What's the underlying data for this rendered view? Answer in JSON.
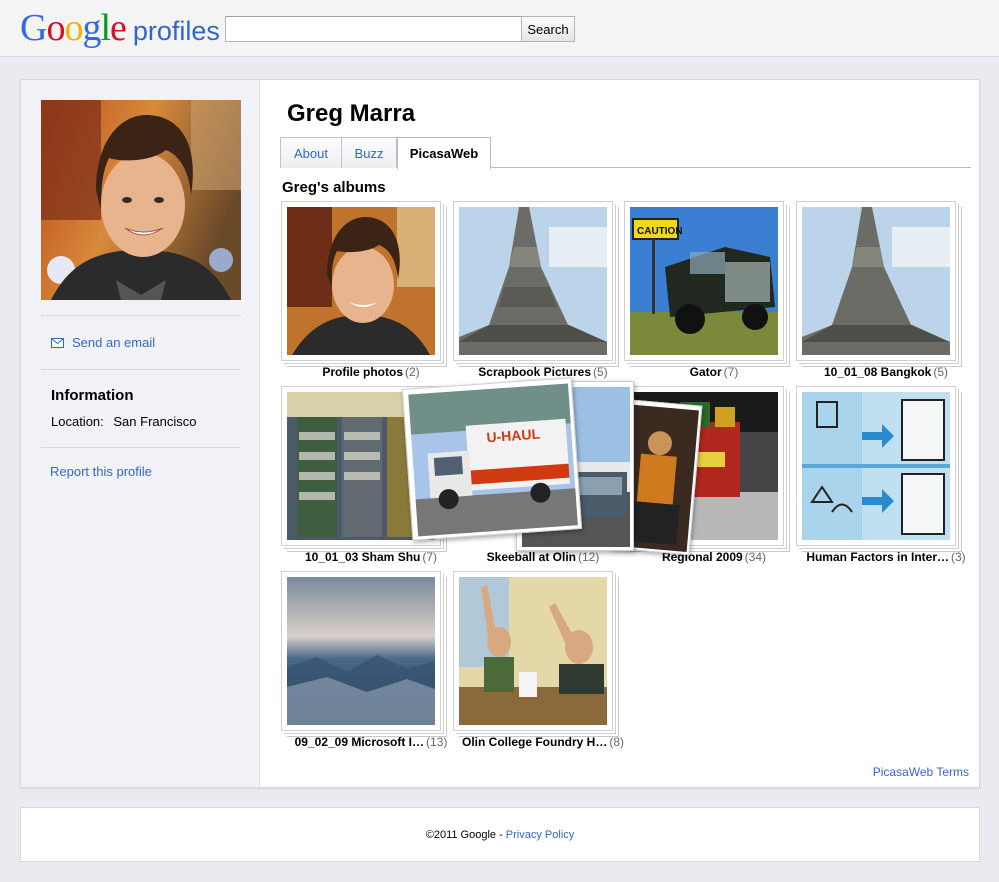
{
  "header": {
    "logo_text": "Google",
    "product": "profiles",
    "search_value": "",
    "search_button": "Search"
  },
  "sidebar": {
    "send_email": "Send an email",
    "info_title": "Information",
    "location_label": "Location:",
    "location_value": "San Francisco",
    "report": "Report this profile"
  },
  "profile": {
    "name": "Greg Marra",
    "tabs": [
      {
        "label": "About",
        "active": false
      },
      {
        "label": "Buzz",
        "active": false
      },
      {
        "label": "PicasaWeb",
        "active": true
      }
    ],
    "albums_title": "Greg's albums"
  },
  "albums": [
    {
      "title": "Profile photos",
      "count": "(2)"
    },
    {
      "title": "Scrapbook Pictures",
      "count": "(5)"
    },
    {
      "title": "Gator",
      "count": "(7)"
    },
    {
      "title": "10_01_08 Bangkok",
      "count": "(5)"
    },
    {
      "title": "10_01_03 Sham Shu",
      "count": "(7)"
    },
    {
      "title": "Skeeball at Olin",
      "count": "(12)"
    },
    {
      "title": "Regional 2009",
      "count": "(34)"
    },
    {
      "title": "Human Factors in Inter…",
      "count": "(3)"
    },
    {
      "title": "09_02_09 Microsoft I…",
      "count": "(13)"
    },
    {
      "title": "Olin College Foundry H…",
      "count": "(8)"
    }
  ],
  "picasa_terms": "PicasaWeb Terms",
  "footer": {
    "copyright": "©2011 Google - ",
    "privacy": "Privacy Policy"
  },
  "colors": {
    "link": "#3366cc",
    "page_bg": "#e9ebf0",
    "sidebar_bg": "#f0f2f7"
  }
}
